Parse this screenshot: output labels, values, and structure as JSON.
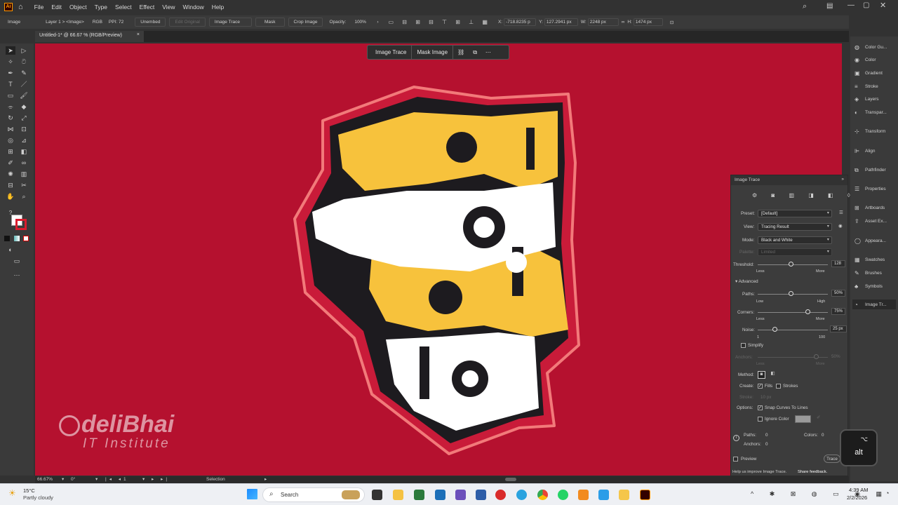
{
  "app": {
    "name": "Adobe Illustrator",
    "logo": "Ai"
  },
  "menu": [
    "File",
    "Edit",
    "Object",
    "Type",
    "Select",
    "Effect",
    "View",
    "Window",
    "Help"
  ],
  "control_bar": {
    "selection_type": "Image",
    "layer": "Layer 1 > <Image>",
    "color_mode": "RGB",
    "ppi": "PPI: 72",
    "unembed": "Unembed",
    "edit_original": "Edit Original",
    "image_trace": "Image Trace",
    "mask": "Mask",
    "crop_image": "Crop Image",
    "opacity_label": "Opacity:",
    "opacity": "100%",
    "x_label": "X:",
    "x": "-718.8235 p",
    "y_label": "Y:",
    "y": "127.2941 px",
    "w_label": "W:",
    "w": "2248 px",
    "h_label": "H:",
    "h": "1474 px"
  },
  "document_tab": {
    "title": "Untitled-1* @ 66.67 % (RGB/Preview)",
    "close": "×"
  },
  "context_bar": {
    "image_trace": "Image Trace",
    "mask_image": "Mask Image"
  },
  "artwork": {
    "watermark_brand": "deliBhai",
    "watermark_sub": "IT Institute"
  },
  "right_panels": [
    "Color Gu...",
    "Color",
    "Gradient",
    "Stroke",
    "Layers",
    "Transpar...",
    "Transform",
    "Align",
    "Pathfinder",
    "Properties",
    "Artboards",
    "Asset Ex...",
    "Appeara...",
    "Swatches",
    "Brushes",
    "Symbols",
    "Image Tr..."
  ],
  "image_trace": {
    "title": "Image Trace",
    "preset_label": "Preset:",
    "preset": "[Default]",
    "view_label": "View:",
    "view": "Tracing Result",
    "mode_label": "Mode:",
    "mode": "Black and White",
    "palette_label": "Palette:",
    "palette": "Limited",
    "threshold_label": "Threshold:",
    "threshold": "128",
    "threshold_min": "Less",
    "threshold_max": "More",
    "advanced": "Advanced",
    "paths_label": "Paths:",
    "paths": "50%",
    "paths_min": "Low",
    "paths_max": "High",
    "corners_label": "Corners:",
    "corners": "75%",
    "corners_min": "Less",
    "corners_max": "More",
    "noise_label": "Noise:",
    "noise": "25 px",
    "noise_min": "1",
    "noise_max": "100",
    "simplify": "Simplify",
    "anchors_label": "Anchors:",
    "anchors_min": "Less",
    "anchors_max": "More",
    "anchors_val": "50%",
    "method_label": "Method:",
    "create_label": "Create:",
    "fills": "Fills",
    "strokes": "Strokes",
    "stroke_label": "Stroke:",
    "stroke_val": "10 px",
    "options_label": "Options:",
    "snap": "Snap Curves To Lines",
    "ignore_color": "Ignore Color",
    "stat_paths_label": "Paths:",
    "stat_paths": "0",
    "stat_colors_label": "Colors:",
    "stat_colors": "0",
    "stat_anchors_label": "Anchors:",
    "stat_anchors": "0",
    "preview": "Preview",
    "trace": "Trace",
    "help": "Help us improve Image Trace.",
    "feedback": "Share feedback."
  },
  "status_bar": {
    "zoom": "66.67%",
    "rotation": "0°",
    "artboard": "1",
    "tool": "Selection"
  },
  "key_overlay": {
    "symbol": "⌥",
    "label": "alt"
  },
  "taskbar": {
    "weather_temp": "15°C",
    "weather_desc": "Partly cloudy",
    "search": "Search",
    "time": "4:39 AM",
    "date": "2/2/2026"
  },
  "colors": {
    "canvas_red": "#b5112f",
    "letter_yellow": "#f7c23c",
    "outline_pink": "#f27a7a"
  }
}
